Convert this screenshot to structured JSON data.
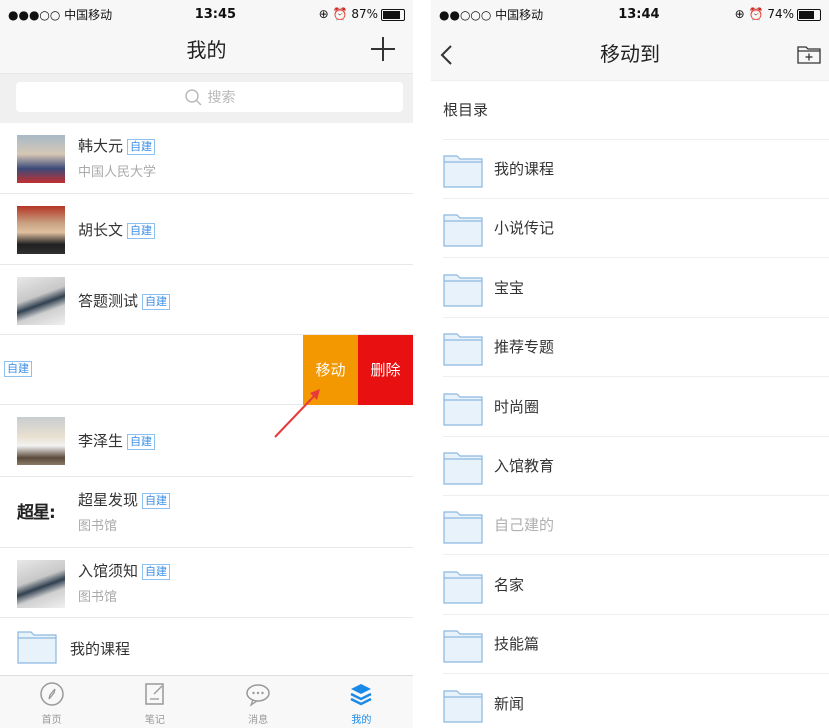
{
  "left": {
    "status": {
      "carrier": "●●●○○ 中国移动",
      "time": "13:45",
      "battery": "87%",
      "battery_level": 0.87
    },
    "nav": {
      "title": "我的"
    },
    "search": {
      "placeholder": "搜索"
    },
    "items": [
      {
        "name": "韩大元",
        "badge": "自建",
        "sub": "中国人民大学"
      },
      {
        "name": "胡长文",
        "badge": "自建"
      },
      {
        "name": "答题测试",
        "badge": "自建"
      },
      {
        "badge": "自建",
        "move": "移动",
        "delete": "删除"
      },
      {
        "name": "李泽生",
        "badge": "自建"
      },
      {
        "name": "超星发现",
        "badge": "自建",
        "sub": "图书馆",
        "logo": "超星:"
      },
      {
        "name": "入馆须知",
        "badge": "自建",
        "sub": "图书馆"
      },
      {
        "name": "我的课程"
      }
    ],
    "tabs": [
      {
        "label": "首页",
        "icon": "compass-icon"
      },
      {
        "label": "笔记",
        "icon": "note-icon"
      },
      {
        "label": "消息",
        "icon": "chat-icon"
      },
      {
        "label": "我的",
        "icon": "layers-icon"
      }
    ]
  },
  "right": {
    "status": {
      "carrier": "●●○○○ 中国移动",
      "time": "13:44",
      "battery": "74%",
      "battery_level": 0.74
    },
    "nav": {
      "title": "移动到"
    },
    "root": "根目录",
    "folders": [
      "我的课程",
      "小说传记",
      "宝宝",
      "推荐专题",
      "时尚圈",
      "入馆教育",
      "自己建的",
      "名家",
      "技能篇",
      "新闻"
    ]
  },
  "colors": {
    "accent": "#1a8ae8",
    "move": "#f39800",
    "delete": "#e81010",
    "arrow": "#e83a3a"
  }
}
